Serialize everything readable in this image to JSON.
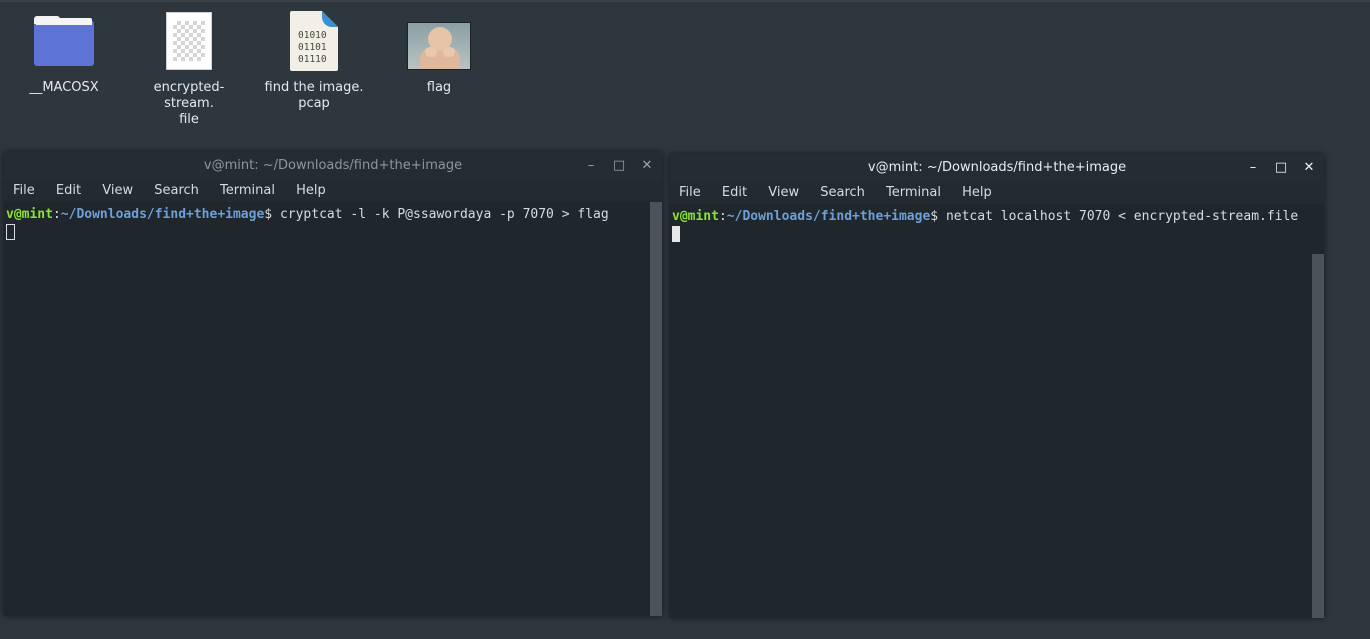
{
  "desktop": {
    "icons": [
      {
        "label": "__MACOSX",
        "icon": "folder-icon"
      },
      {
        "label": "encrypted-stream.\nfile",
        "icon": "blank-file-icon"
      },
      {
        "label": "find the image.\npcap",
        "icon": "binary-file-icon"
      },
      {
        "label": "flag",
        "icon": "image-thumbnail-icon"
      }
    ],
    "binary_glyph_lines": [
      "01010",
      "01101",
      "01110"
    ]
  },
  "terminal_left": {
    "title": "v@mint: ~/Downloads/find+the+image",
    "menu": [
      "File",
      "Edit",
      "View",
      "Search",
      "Terminal",
      "Help"
    ],
    "prompt_user": "v@mint",
    "prompt_sep": ":",
    "prompt_path": "~/Downloads/find+the+image",
    "prompt_symbol": "$",
    "command": " cryptcat -l -k P@ssawordaya -p 7070 > flag",
    "controls": [
      "–",
      "□",
      "✕"
    ]
  },
  "terminal_right": {
    "title": "v@mint: ~/Downloads/find+the+image",
    "menu": [
      "File",
      "Edit",
      "View",
      "Search",
      "Terminal",
      "Help"
    ],
    "prompt_user": "v@mint",
    "prompt_sep": ":",
    "prompt_path": "~/Downloads/find+the+image",
    "prompt_symbol": "$",
    "command": " netcat localhost 7070 < encrypted-stream.file",
    "controls": [
      "–",
      "□",
      "✕"
    ]
  },
  "colors": {
    "desktop_bg": "#2f373e",
    "terminal_bg": "#1f272c",
    "prompt_user": "#8ae234",
    "prompt_path": "#6f9fd8",
    "folder": "#5e73d6",
    "binary_fold": "#3d8fd1"
  }
}
